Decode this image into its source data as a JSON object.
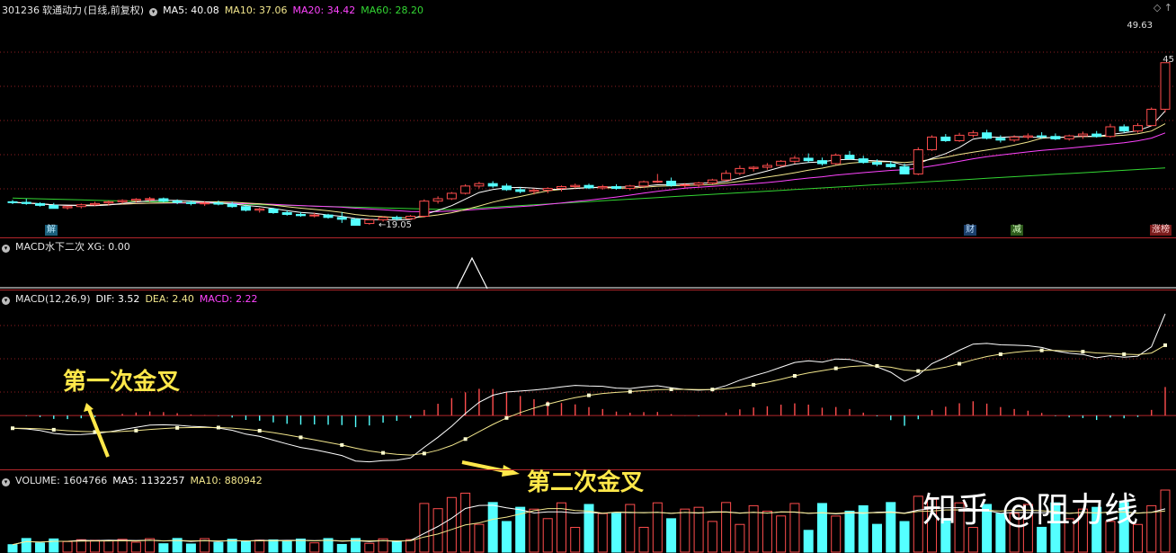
{
  "main": {
    "code": "301236",
    "name": "软通动力",
    "period": "(日线,前复权)",
    "ma5": "MA5: 40.08",
    "ma10": "MA10: 37.06",
    "ma20": "MA20: 34.42",
    "ma60": "MA60: 28.20",
    "high_label": "49.63",
    "close_label": "45",
    "low_label": "19.05",
    "markers": [
      "解",
      "财",
      "减",
      "涨榜"
    ]
  },
  "xg": {
    "label": "MACD水下二次",
    "value": "XG: 0.00"
  },
  "macd": {
    "label": "MACD(12,26,9)",
    "dif": "DIF: 3.52",
    "dea": "DEA: 2.40",
    "macd": "MACD: 2.22",
    "annot1": "第一次金叉",
    "annot2": "第二次金叉"
  },
  "volume": {
    "label": "VOLUME: 1604766",
    "ma5": "MA5: 1132257",
    "ma10": "MA10: 880942"
  },
  "watermark": "知乎 @阻力线",
  "colors": {
    "up": "#ff4d4d",
    "down": "#54ffff",
    "ma5": "#ffffff",
    "ma10": "#f2e68c",
    "ma20": "#ff44ff",
    "ma60": "#33d633",
    "grid": "#b3262b",
    "annotation": "#ffe84a"
  },
  "chart_data": {
    "type": "candlestick",
    "price_range": [
      17,
      53
    ],
    "candles": [
      [
        22.6,
        22.9,
        22.2,
        22.5
      ],
      [
        22.5,
        23.1,
        22.1,
        22.3
      ],
      [
        22.3,
        22.5,
        21.8,
        22.0
      ],
      [
        22.0,
        22.4,
        21.7,
        21.5
      ],
      [
        21.6,
        21.9,
        21.3,
        21.8
      ],
      [
        21.8,
        22.3,
        21.5,
        22.1
      ],
      [
        22.1,
        22.6,
        21.9,
        22.3
      ],
      [
        22.4,
        22.8,
        22.0,
        22.6
      ],
      [
        22.6,
        23.0,
        22.3,
        22.8
      ],
      [
        22.8,
        23.2,
        22.5,
        23.0
      ],
      [
        23.0,
        23.4,
        22.6,
        23.1
      ],
      [
        23.1,
        23.3,
        22.5,
        22.7
      ],
      [
        22.7,
        23.0,
        22.2,
        22.5
      ],
      [
        22.5,
        22.8,
        22.0,
        22.3
      ],
      [
        22.3,
        22.7,
        21.9,
        22.4
      ],
      [
        22.4,
        22.8,
        22.0,
        22.2
      ],
      [
        22.2,
        22.6,
        21.6,
        21.8
      ],
      [
        21.8,
        22.1,
        21.0,
        21.2
      ],
      [
        21.2,
        21.6,
        20.8,
        21.4
      ],
      [
        21.4,
        21.6,
        20.6,
        20.8
      ],
      [
        20.8,
        21.2,
        20.3,
        20.5
      ],
      [
        20.5,
        20.9,
        20.1,
        20.3
      ],
      [
        20.3,
        20.8,
        20.0,
        20.4
      ],
      [
        20.4,
        20.6,
        19.8,
        20.0
      ],
      [
        20.0,
        20.9,
        19.1,
        19.7
      ],
      [
        19.7,
        19.9,
        19.0,
        18.7
      ],
      [
        19.0,
        19.7,
        18.8,
        19.6
      ],
      [
        19.6,
        20.2,
        19.3,
        20.0
      ],
      [
        20.0,
        20.3,
        19.5,
        19.8
      ],
      [
        19.8,
        20.4,
        19.6,
        20.2
      ],
      [
        20.2,
        23.0,
        20.0,
        22.7
      ],
      [
        22.7,
        23.5,
        22.3,
        23.1
      ],
      [
        23.1,
        24.2,
        22.9,
        24.0
      ],
      [
        24.0,
        25.5,
        23.8,
        25.2
      ],
      [
        25.2,
        25.9,
        24.8,
        25.6
      ],
      [
        25.6,
        26.0,
        24.9,
        25.2
      ],
      [
        25.2,
        25.6,
        24.4,
        24.6
      ],
      [
        24.6,
        25.0,
        24.0,
        24.3
      ],
      [
        24.3,
        24.8,
        23.8,
        24.5
      ],
      [
        24.5,
        25.0,
        24.0,
        24.8
      ],
      [
        24.8,
        25.3,
        24.3,
        25.1
      ],
      [
        25.1,
        25.6,
        24.8,
        25.3
      ],
      [
        25.3,
        25.6,
        24.7,
        24.9
      ],
      [
        24.9,
        25.4,
        24.6,
        25.1
      ],
      [
        25.1,
        25.5,
        24.6,
        24.8
      ],
      [
        24.8,
        25.4,
        24.5,
        25.2
      ],
      [
        25.2,
        26.1,
        24.9,
        25.9
      ],
      [
        25.9,
        27.2,
        25.7,
        26.0
      ],
      [
        26.0,
        26.6,
        25.1,
        25.3
      ],
      [
        25.3,
        25.7,
        24.9,
        25.4
      ],
      [
        25.4,
        25.9,
        25.0,
        25.7
      ],
      [
        25.7,
        26.4,
        25.5,
        26.2
      ],
      [
        26.2,
        27.8,
        26.0,
        27.3
      ],
      [
        27.3,
        28.6,
        27.0,
        28.1
      ],
      [
        28.1,
        28.5,
        27.6,
        28.3
      ],
      [
        28.3,
        29.0,
        27.9,
        28.6
      ],
      [
        28.6,
        29.5,
        28.4,
        29.3
      ],
      [
        29.3,
        30.2,
        28.9,
        29.8
      ],
      [
        29.8,
        30.6,
        29.1,
        29.4
      ],
      [
        29.4,
        29.9,
        28.6,
        28.9
      ],
      [
        28.9,
        30.6,
        28.7,
        30.3
      ],
      [
        30.3,
        31.0,
        29.6,
        29.7
      ],
      [
        29.7,
        30.2,
        28.9,
        29.1
      ],
      [
        29.1,
        29.6,
        28.5,
        28.8
      ],
      [
        28.8,
        29.3,
        28.2,
        28.4
      ],
      [
        28.4,
        28.9,
        27.6,
        27.2
      ],
      [
        27.2,
        31.6,
        27.0,
        31.2
      ],
      [
        31.2,
        33.6,
        31.0,
        33.3
      ],
      [
        33.3,
        33.8,
        32.5,
        32.7
      ],
      [
        32.7,
        34.0,
        32.5,
        33.6
      ],
      [
        33.6,
        34.4,
        33.2,
        34.0
      ],
      [
        34.0,
        34.5,
        32.9,
        33.1
      ],
      [
        33.1,
        33.6,
        32.4,
        32.8
      ],
      [
        32.8,
        33.6,
        32.5,
        33.3
      ],
      [
        33.3,
        33.9,
        32.9,
        33.5
      ],
      [
        33.5,
        34.1,
        33.0,
        33.4
      ],
      [
        33.4,
        33.9,
        32.8,
        33.0
      ],
      [
        33.0,
        33.7,
        32.7,
        33.5
      ],
      [
        33.5,
        34.2,
        33.0,
        33.8
      ],
      [
        33.8,
        34.3,
        33.2,
        33.4
      ],
      [
        33.4,
        35.5,
        33.2,
        35.0
      ],
      [
        35.0,
        35.4,
        34.0,
        34.3
      ],
      [
        34.3,
        35.6,
        34.0,
        35.2
      ],
      [
        35.2,
        38.2,
        36.8,
        37.9
      ],
      [
        37.9,
        42.1,
        37.4,
        45.6
      ]
    ],
    "ma_lines": {
      "ma5_last": 40.08,
      "ma10_last": 37.06,
      "ma20_last": 34.42,
      "ma60_last": 28.2
    },
    "macd": {
      "dif": 3.52,
      "dea": 2.4,
      "macd": 2.22,
      "range": [
        -1.8,
        3.8
      ]
    },
    "volume": {
      "last": 1604766,
      "ma5": 1132257,
      "ma10": 880942
    }
  }
}
